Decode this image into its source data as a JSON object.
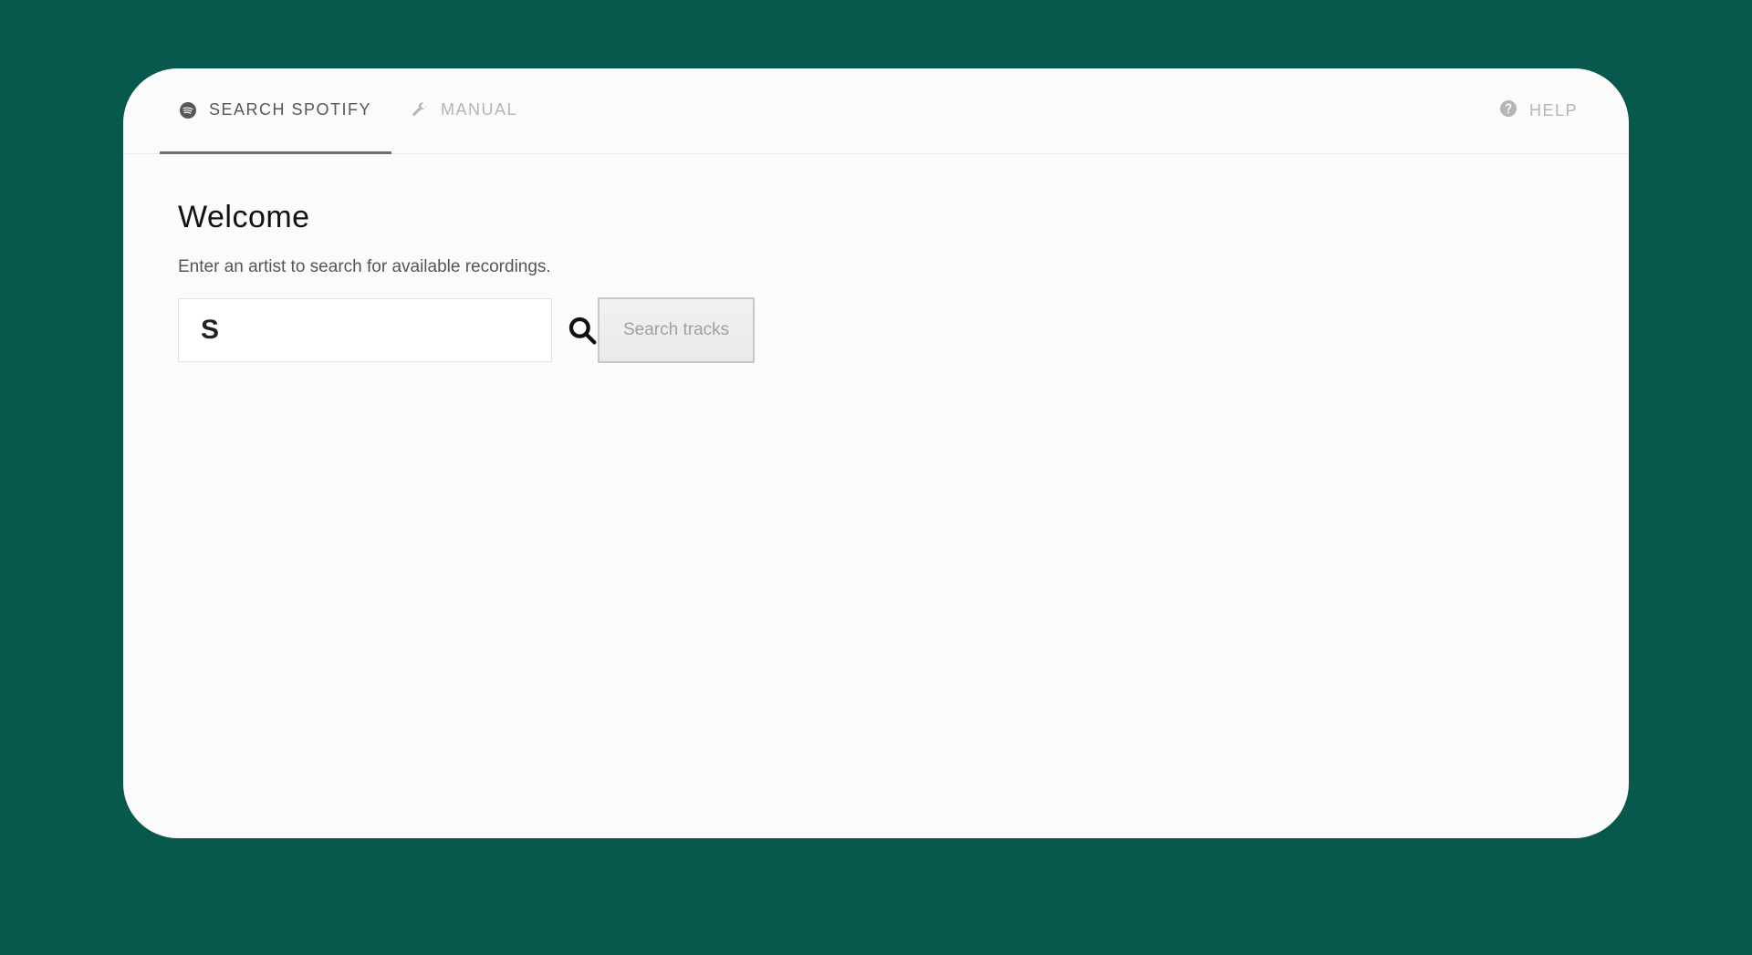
{
  "nav": {
    "tabs": [
      {
        "label": "SEARCH SPOTIFY"
      },
      {
        "label": "MANUAL"
      }
    ],
    "help_label": "HELP"
  },
  "main": {
    "heading": "Welcome",
    "instruction": "Enter an artist to search for available recordings.",
    "search_value": "S",
    "search_button": "Search tracks"
  }
}
